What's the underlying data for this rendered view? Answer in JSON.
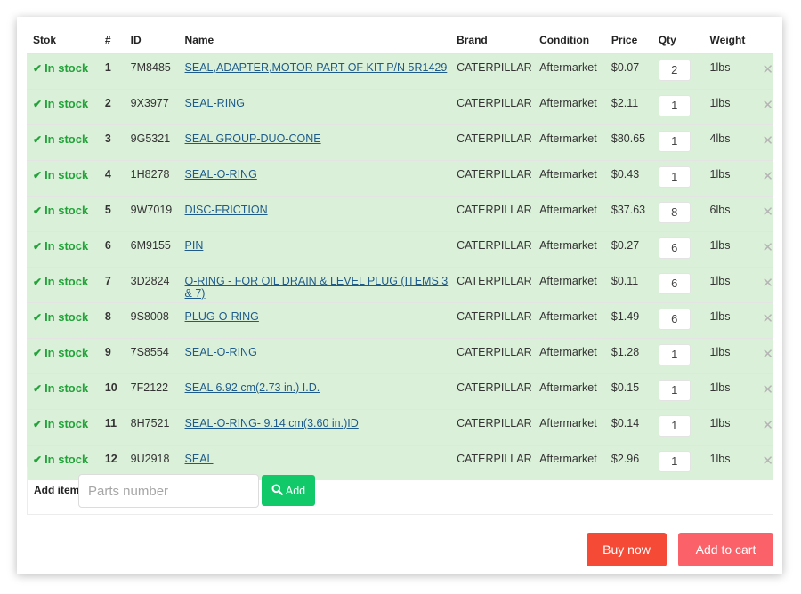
{
  "table": {
    "headers": {
      "stock": "Stok",
      "num": "#",
      "id": "ID",
      "name": "Name",
      "brand": "Brand",
      "condition": "Condition",
      "price": "Price",
      "qty": "Qty",
      "weight": "Weight"
    },
    "rows": [
      {
        "stock": "In stock",
        "num": "1",
        "id": "7M8485",
        "name": "SEAL,ADAPTER,MOTOR PART OF KIT P/N 5R1429",
        "brand": "CATERPILLAR",
        "condition": "Aftermarket",
        "price": "$0.07",
        "qty": "2",
        "weight": "1lbs"
      },
      {
        "stock": "In stock",
        "num": "2",
        "id": "9X3977",
        "name": "SEAL-RING",
        "brand": "CATERPILLAR",
        "condition": "Aftermarket",
        "price": "$2.11",
        "qty": "1",
        "weight": "1lbs"
      },
      {
        "stock": "In stock",
        "num": "3",
        "id": "9G5321",
        "name": "SEAL GROUP-DUO-CONE",
        "brand": "CATERPILLAR",
        "condition": "Aftermarket",
        "price": "$80.65",
        "qty": "1",
        "weight": "4lbs"
      },
      {
        "stock": "In stock",
        "num": "4",
        "id": "1H8278",
        "name": "SEAL-O-RING",
        "brand": "CATERPILLAR",
        "condition": "Aftermarket",
        "price": "$0.43",
        "qty": "1",
        "weight": "1lbs"
      },
      {
        "stock": "In stock",
        "num": "5",
        "id": "9W7019",
        "name": "DISC-FRICTION",
        "brand": "CATERPILLAR",
        "condition": "Aftermarket",
        "price": "$37.63",
        "qty": "8",
        "weight": "6lbs"
      },
      {
        "stock": "In stock",
        "num": "6",
        "id": "6M9155",
        "name": "PIN",
        "brand": "CATERPILLAR",
        "condition": "Aftermarket",
        "price": "$0.27",
        "qty": "6",
        "weight": "1lbs"
      },
      {
        "stock": "In stock",
        "num": "7",
        "id": "3D2824",
        "name": "O-RING - FOR OIL DRAIN & LEVEL PLUG (ITEMS 3 & 7)",
        "brand": "CATERPILLAR",
        "condition": "Aftermarket",
        "price": "$0.11",
        "qty": "6",
        "weight": "1lbs"
      },
      {
        "stock": "In stock",
        "num": "8",
        "id": "9S8008",
        "name": "PLUG-O-RING",
        "brand": "CATERPILLAR",
        "condition": "Aftermarket",
        "price": "$1.49",
        "qty": "6",
        "weight": "1lbs"
      },
      {
        "stock": "In stock",
        "num": "9",
        "id": "7S8554",
        "name": "SEAL-O-RING",
        "brand": "CATERPILLAR",
        "condition": "Aftermarket",
        "price": "$1.28",
        "qty": "1",
        "weight": "1lbs"
      },
      {
        "stock": "In stock",
        "num": "10",
        "id": "7F2122",
        "name": "SEAL 6.92 cm(2.73 in.) I.D.",
        "brand": "CATERPILLAR",
        "condition": "Aftermarket",
        "price": "$0.15",
        "qty": "1",
        "weight": "1lbs"
      },
      {
        "stock": "In stock",
        "num": "11",
        "id": "8H7521",
        "name": "SEAL-O-RING- 9.14 cm(3.60 in.)ID",
        "brand": "CATERPILLAR",
        "condition": "Aftermarket",
        "price": "$0.14",
        "qty": "1",
        "weight": "1lbs"
      },
      {
        "stock": "In stock",
        "num": "12",
        "id": "9U2918",
        "name": "SEAL",
        "brand": "CATERPILLAR",
        "condition": "Aftermarket",
        "price": "$2.96",
        "qty": "1",
        "weight": "1lbs"
      }
    ]
  },
  "icons": {
    "check": "✔",
    "remove": "✕"
  },
  "add_item": {
    "label": "Add item",
    "placeholder": "Parts number",
    "value": "",
    "button_label": "Add",
    "button_icon": "search-icon"
  },
  "actions": {
    "buy_now": "Buy now",
    "add_to_cart": "Add to cart"
  },
  "colors": {
    "in_stock": "#22a33a",
    "row_bg": "#dbf0d9",
    "link": "#1e5b8a",
    "add_button": "#12c96a",
    "buy_now": "#f44a36",
    "add_to_cart": "#fa6168"
  }
}
